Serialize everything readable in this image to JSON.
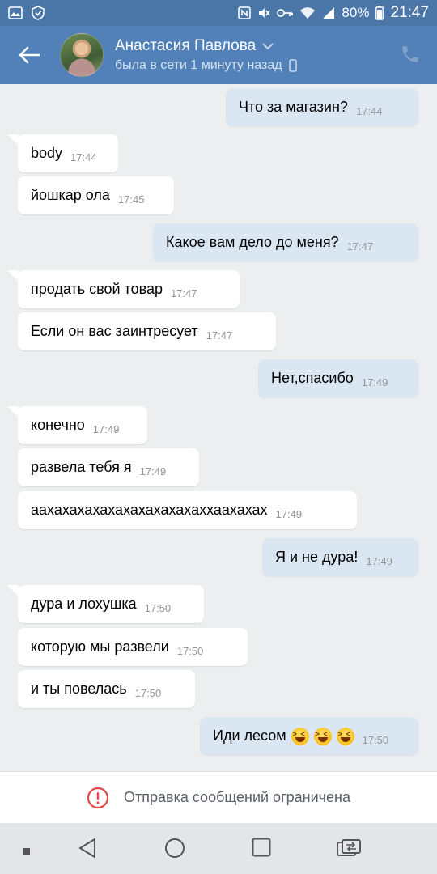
{
  "status_bar": {
    "battery": "80%",
    "time": "21:47"
  },
  "header": {
    "name": "Анастасия Павлова",
    "status": "была в сети 1 минуту назад"
  },
  "messages": [
    {
      "dir": "out",
      "text": "Что за магазин?",
      "time": "17:44"
    },
    {
      "dir": "in",
      "text": "body",
      "time": "17:44"
    },
    {
      "dir": "in",
      "text": "йошкар ола",
      "time": "17:45"
    },
    {
      "dir": "out",
      "text": "Какое вам дело до меня?",
      "time": "17:47"
    },
    {
      "dir": "in",
      "text": "продать свой товар",
      "time": "17:47"
    },
    {
      "dir": "in",
      "text": "Если он вас заинтресует",
      "time": "17:47"
    },
    {
      "dir": "out",
      "text": "Нет,спасибо",
      "time": "17:49"
    },
    {
      "dir": "in",
      "text": "конечно",
      "time": "17:49"
    },
    {
      "dir": "in",
      "text": "развела тебя я",
      "time": "17:49"
    },
    {
      "dir": "in",
      "text": "аахахахахахахахахахахаххаахахах",
      "time": "17:49"
    },
    {
      "dir": "out",
      "text": "Я и не дура!",
      "time": "17:49"
    },
    {
      "dir": "in",
      "text": "дура и лохушка",
      "time": "17:50"
    },
    {
      "dir": "in",
      "text": "которую мы развели",
      "time": "17:50"
    },
    {
      "dir": "in",
      "text": "и ты повелась",
      "time": "17:50"
    },
    {
      "dir": "out",
      "text": "Иди лесом",
      "time": "17:50",
      "emoji": [
        "laughing-face",
        "laughing-face",
        "laughing-face"
      ]
    }
  ],
  "restriction_notice": "Отправка сообщений ограничена",
  "colors": {
    "header": "#5181b8",
    "status_bar": "#4a76a8",
    "incoming_bubble": "#ffffff",
    "outgoing_bubble": "#dbe6f3",
    "background": "#edeef0",
    "alert_red": "#e64646"
  }
}
